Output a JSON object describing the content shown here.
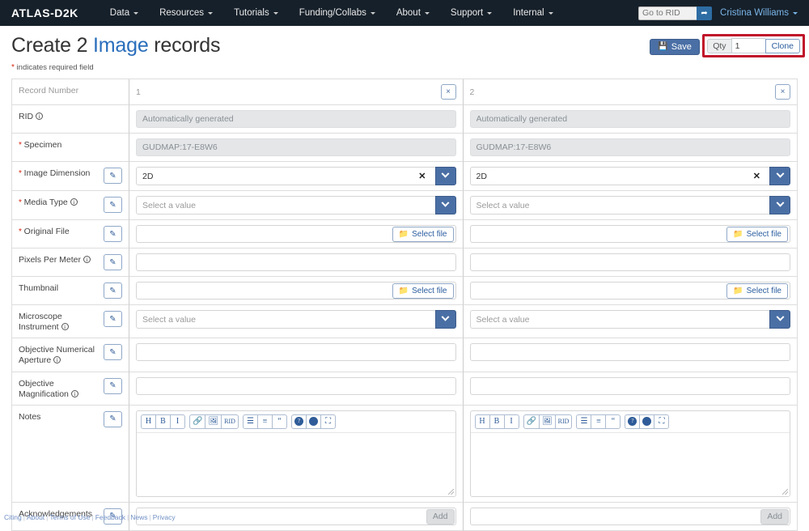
{
  "navbar": {
    "brand": "ATLAS-D2K",
    "items": [
      {
        "label": "Data"
      },
      {
        "label": "Resources"
      },
      {
        "label": "Tutorials"
      },
      {
        "label": "Funding/Collabs"
      },
      {
        "label": "About"
      },
      {
        "label": "Support"
      },
      {
        "label": "Internal"
      }
    ],
    "rid_placeholder": "Go to RID",
    "rid_value": "",
    "go_icon": "➦",
    "user": "Cristina Williams"
  },
  "header": {
    "title_prefix": "Create 2 ",
    "title_highlight": "Image",
    "title_suffix": " records",
    "required_note": "indicates required field",
    "save_label": "Save",
    "save_icon": "💾",
    "qty_label": "Qty",
    "qty_value": "1",
    "clone_label": "Clone",
    "highlight_color": "#c0132a"
  },
  "form": {
    "rows": [
      {
        "label": "Record Number",
        "required": false,
        "info": false,
        "muted": true,
        "editable": false,
        "type": "recordnum",
        "values": [
          "1",
          "2"
        ],
        "close_icon": "×"
      },
      {
        "label": "RID",
        "required": false,
        "info": true,
        "editable": false,
        "type": "text-disabled",
        "values": [
          "Automatically generated",
          "Automatically generated"
        ]
      },
      {
        "label": "Specimen",
        "required": true,
        "info": false,
        "editable": false,
        "type": "text-disabled",
        "values": [
          "GUDMAP:17-E8W6",
          "GUDMAP:17-E8W6"
        ]
      },
      {
        "label": "Image Dimension",
        "required": true,
        "info": false,
        "editable": true,
        "type": "select-filled",
        "values": [
          "2D",
          "2D"
        ],
        "clear_icon": "✕"
      },
      {
        "label": "Media Type",
        "required": true,
        "info": true,
        "editable": true,
        "type": "select-empty",
        "values": [
          "Select a value",
          "Select a value"
        ]
      },
      {
        "label": "Original File",
        "required": true,
        "info": false,
        "editable": true,
        "type": "file",
        "values": [
          "",
          ""
        ],
        "button": "Select file",
        "button_icon": "📁"
      },
      {
        "label": "Pixels Per Meter",
        "required": false,
        "info": true,
        "editable": true,
        "type": "text",
        "values": [
          "",
          ""
        ]
      },
      {
        "label": "Thumbnail",
        "required": false,
        "info": false,
        "editable": true,
        "type": "file",
        "values": [
          "",
          ""
        ],
        "button": "Select file",
        "button_icon": "📁"
      },
      {
        "label": "Microscope Instrument",
        "required": false,
        "info": true,
        "editable": true,
        "type": "select-empty",
        "values": [
          "Select a value",
          "Select a value"
        ]
      },
      {
        "label": "Objective Numerical Aperture",
        "required": false,
        "info": true,
        "editable": true,
        "type": "text",
        "values": [
          "",
          ""
        ]
      },
      {
        "label": "Objective Magnification",
        "required": false,
        "info": true,
        "editable": true,
        "type": "text",
        "values": [
          "",
          ""
        ]
      },
      {
        "label": "Notes",
        "required": false,
        "info": false,
        "editable": true,
        "type": "markdown",
        "values": [
          "",
          ""
        ]
      },
      {
        "label": "Acknowledgements",
        "required": false,
        "info": false,
        "editable": true,
        "type": "add",
        "values": [
          "",
          ""
        ],
        "button": "Add"
      }
    ],
    "markdown_toolbar": [
      {
        "name": "heading-icon",
        "glyph": "H"
      },
      {
        "name": "bold-icon",
        "glyph": "B"
      },
      {
        "name": "italic-icon",
        "glyph": "I"
      },
      {
        "name": "link-icon",
        "glyph": "🔗"
      },
      {
        "name": "image-icon",
        "glyph": "🖼"
      },
      {
        "name": "rid-icon",
        "glyph": "RID"
      },
      {
        "name": "bullet-list-icon",
        "glyph": "☰"
      },
      {
        "name": "numbered-list-icon",
        "glyph": "≡"
      },
      {
        "name": "blockquote-icon",
        "glyph": "“"
      },
      {
        "name": "help-icon",
        "glyph": "?"
      },
      {
        "name": "preview-icon",
        "glyph": "◉"
      },
      {
        "name": "fullscreen-icon",
        "glyph": "⛶"
      }
    ]
  },
  "footer": {
    "links": [
      "Citing",
      "About",
      "Terms of Use",
      "Feedback",
      "News",
      "Privacy"
    ]
  }
}
